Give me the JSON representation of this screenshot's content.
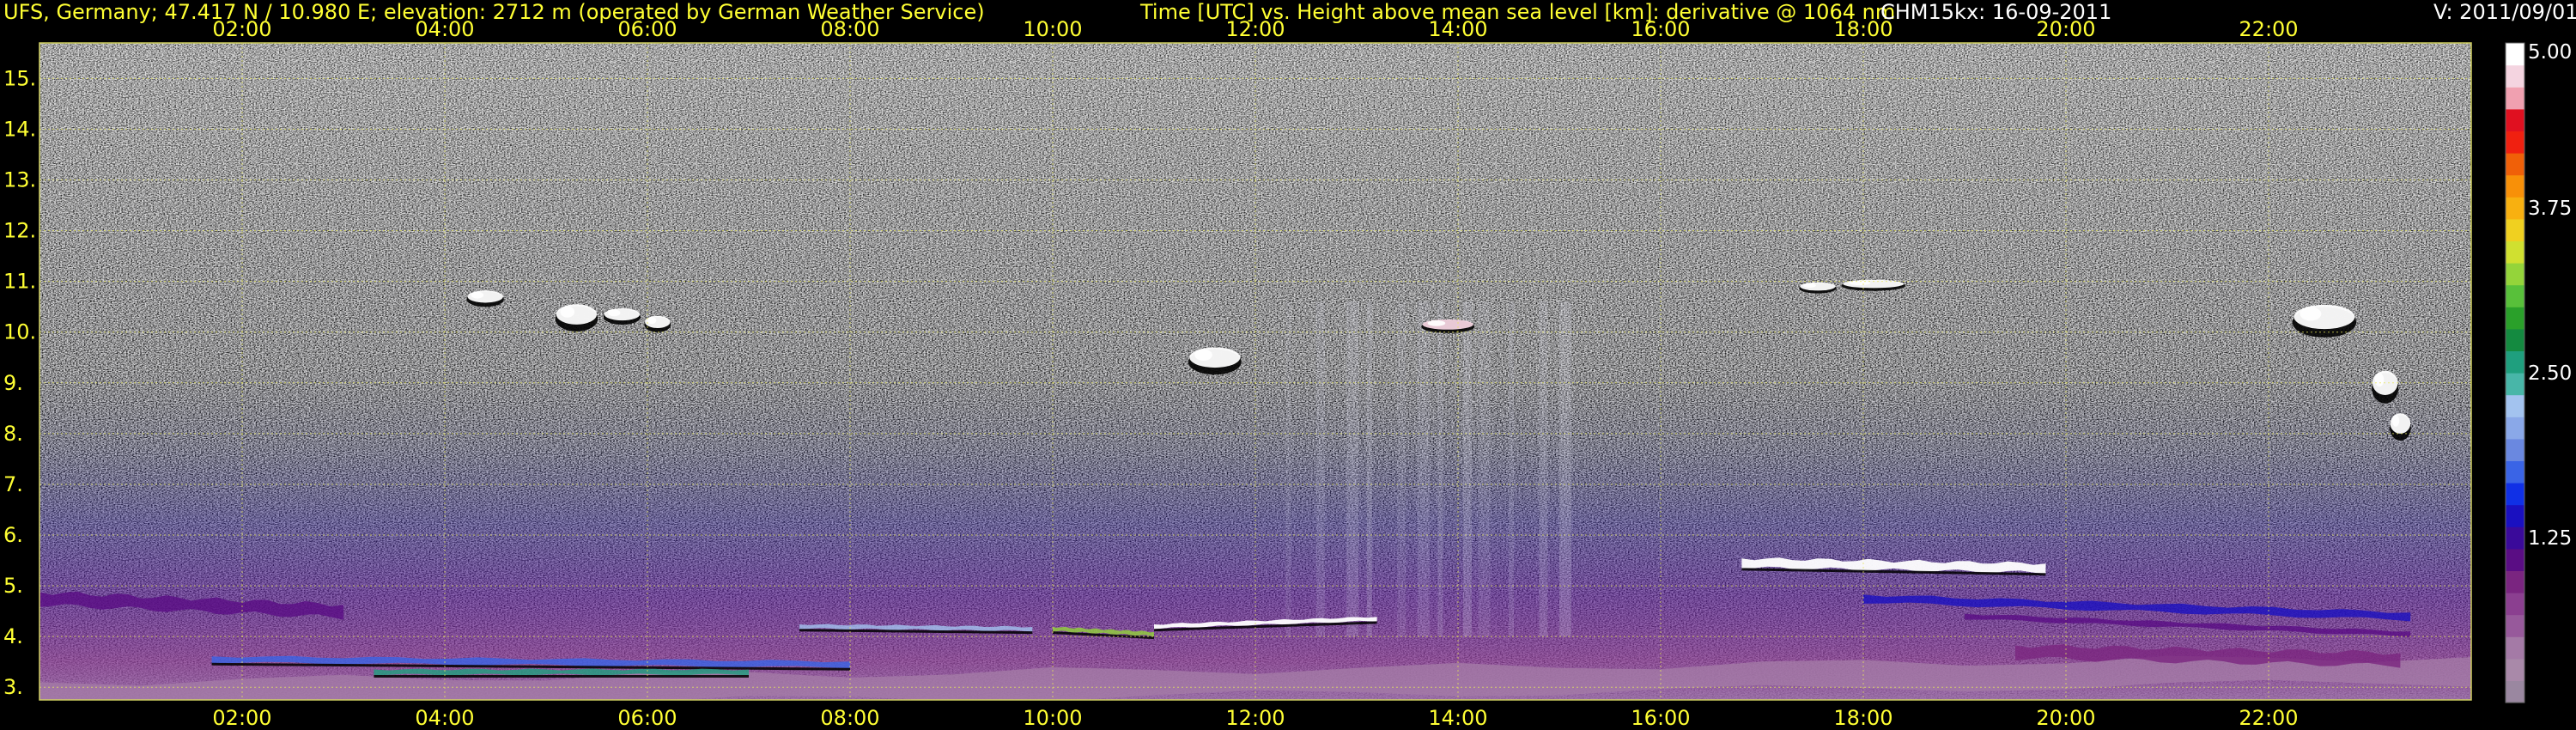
{
  "header": {
    "station": "UFS, Germany; 47.417 N / 10.980 E; elevation: 2712 m  (operated by German Weather Service)",
    "plot_title": "Time [UTC] vs. Height above mean sea level [km]: derivative @ 1064 nm",
    "instrument_date": "CHM15kx: 16-09-2011",
    "version": "V: 2011/09/01"
  },
  "colors": {
    "background": "#000000",
    "header_text": "#ffff33",
    "grid": "#e8e85a",
    "colorbar": [
      "#9a87a0",
      "#a989a9",
      "#a47aa6",
      "#97599b",
      "#8b3f90",
      "#7a2580",
      "#5a0d84",
      "#3a0a9a",
      "#1a10c0",
      "#1030e6",
      "#3a64e6",
      "#6a88e0",
      "#8aa8e8",
      "#a3c3ef",
      "#48b6a8",
      "#1f9f7e",
      "#148a40",
      "#2aa02a",
      "#58c03a",
      "#94d43a",
      "#d0e030",
      "#f0d020",
      "#f8b010",
      "#f89008",
      "#f06008",
      "#f02010",
      "#e01020",
      "#f0a0b0",
      "#f4d4e0",
      "#ffffff"
    ]
  },
  "chart_data": {
    "type": "heatmap",
    "title": "Time [UTC] vs. Height above mean sea level [km]: derivative @ 1064 nm",
    "xlabel": "Time [UTC]",
    "ylabel": "Height above mean sea level [km]",
    "x_unit": "hours UTC",
    "xlim": [
      0,
      24
    ],
    "ylim": [
      2.75,
      15.7
    ],
    "x_ticks": [
      {
        "value": 2,
        "label": "02:00"
      },
      {
        "value": 4,
        "label": "04:00"
      },
      {
        "value": 6,
        "label": "06:00"
      },
      {
        "value": 8,
        "label": "08:00"
      },
      {
        "value": 10,
        "label": "10:00"
      },
      {
        "value": 12,
        "label": "12:00"
      },
      {
        "value": 14,
        "label": "14:00"
      },
      {
        "value": 16,
        "label": "16:00"
      },
      {
        "value": 18,
        "label": "18:00"
      },
      {
        "value": 20,
        "label": "20:00"
      },
      {
        "value": 22,
        "label": "22:00"
      }
    ],
    "y_ticks": [
      {
        "value": 3,
        "label": "3."
      },
      {
        "value": 4,
        "label": "4."
      },
      {
        "value": 5,
        "label": "5."
      },
      {
        "value": 6,
        "label": "6."
      },
      {
        "value": 7,
        "label": "7."
      },
      {
        "value": 8,
        "label": "8."
      },
      {
        "value": 9,
        "label": "9."
      },
      {
        "value": 10,
        "label": "10."
      },
      {
        "value": 11,
        "label": "11."
      },
      {
        "value": 12,
        "label": "12."
      },
      {
        "value": 13,
        "label": "13."
      },
      {
        "value": 14,
        "label": "14."
      },
      {
        "value": 15,
        "label": "15."
      }
    ],
    "grid": true,
    "colorbar": {
      "range": [
        0,
        5
      ],
      "ticks": [
        {
          "value": 5.0,
          "label": "5.00"
        },
        {
          "value": 3.75,
          "label": "3.75"
        },
        {
          "value": 2.5,
          "label": "2.50"
        },
        {
          "value": 1.25,
          "label": "1.25"
        }
      ]
    },
    "layers": [
      {
        "x_start": 0.0,
        "x_end": 24.0,
        "height_start": 2.85,
        "height_end": 3.35,
        "level": 0.4,
        "thickness": 0.5
      },
      {
        "x_start": 0.0,
        "x_end": 3.0,
        "height_start": 4.75,
        "height_end": 4.5,
        "level": 1.1,
        "thickness": 0.25
      },
      {
        "x_start": 1.7,
        "x_end": 8.0,
        "height_start": 3.55,
        "height_end": 3.45,
        "level": 1.8,
        "thickness": 0.12
      },
      {
        "x_start": 3.3,
        "x_end": 7.0,
        "height_start": 3.3,
        "height_end": 3.3,
        "level": 2.6,
        "thickness": 0.1
      },
      {
        "x_start": 7.5,
        "x_end": 9.8,
        "height_start": 4.2,
        "height_end": 4.15,
        "level": 2.3,
        "thickness": 0.08
      },
      {
        "x_start": 10.0,
        "x_end": 11.0,
        "height_start": 4.15,
        "height_end": 4.05,
        "level": 3.2,
        "thickness": 0.08
      },
      {
        "x_start": 11.0,
        "x_end": 13.2,
        "height_start": 4.2,
        "height_end": 4.35,
        "level": 4.9,
        "thickness": 0.08
      },
      {
        "x_start": 16.8,
        "x_end": 19.8,
        "height_start": 5.45,
        "height_end": 5.35,
        "level": 4.9,
        "thickness": 0.18
      },
      {
        "x_start": 18.0,
        "x_end": 23.4,
        "height_start": 4.75,
        "height_end": 4.4,
        "level": 1.4,
        "thickness": 0.15
      },
      {
        "x_start": 19.0,
        "x_end": 23.4,
        "height_start": 4.4,
        "height_end": 4.05,
        "level": 1.0,
        "thickness": 0.1
      },
      {
        "x_start": 19.5,
        "x_end": 23.3,
        "height_start": 3.7,
        "height_end": 3.55,
        "level": 0.9,
        "thickness": 0.25
      }
    ],
    "clouds": [
      {
        "x": 4.4,
        "height": 10.7,
        "width": 0.35,
        "depth": 0.3,
        "level": 5.0
      },
      {
        "x": 5.3,
        "height": 10.35,
        "width": 0.4,
        "depth": 0.5,
        "level": 5.0
      },
      {
        "x": 5.75,
        "height": 10.35,
        "width": 0.35,
        "depth": 0.3,
        "level": 5.0
      },
      {
        "x": 6.1,
        "height": 10.2,
        "width": 0.25,
        "depth": 0.3,
        "level": 5.0
      },
      {
        "x": 11.6,
        "height": 9.5,
        "width": 0.5,
        "depth": 0.5,
        "level": 5.0
      },
      {
        "x": 13.9,
        "height": 10.15,
        "width": 0.5,
        "depth": 0.25,
        "level": 4.8
      },
      {
        "x": 17.55,
        "height": 10.9,
        "width": 0.35,
        "depth": 0.2,
        "level": 5.0
      },
      {
        "x": 18.1,
        "height": 10.95,
        "width": 0.6,
        "depth": 0.2,
        "level": 5.0
      },
      {
        "x": 22.55,
        "height": 10.3,
        "width": 0.6,
        "depth": 0.6,
        "level": 5.0
      },
      {
        "x": 23.15,
        "height": 9.0,
        "width": 0.25,
        "depth": 0.6,
        "level": 5.0
      },
      {
        "x": 23.3,
        "height": 8.2,
        "width": 0.2,
        "depth": 0.5,
        "level": 5.0
      }
    ]
  }
}
